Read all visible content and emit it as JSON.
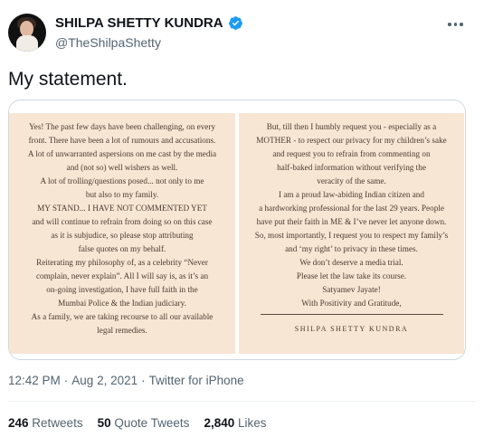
{
  "author": {
    "display_name": "SHILPA SHETTY KUNDRA",
    "handle": "@TheShilpaShetty",
    "verified_color": "#1d9bf0"
  },
  "tweet": {
    "text": "My statement."
  },
  "media": {
    "left_panel_lines": [
      "Yes! The past few days have been challenging, on every",
      "front. There have been a lot of rumours and accusations.",
      "A lot of unwarranted aspersions on me cast by the media",
      "and (not so) well wishers as well.",
      "A lot of trolling/questions posed... not only to me",
      "but also to my family.",
      "MY STAND... I HAVE NOT COMMENTED YET",
      "and will continue to refrain from doing so on this case",
      "as it is subjudice, so please stop attributing",
      "false quotes on my behalf.",
      "Reiterating my philosophy of, as a celebrity “Never",
      "complain, never explain”. All I will say is, as it’s an",
      "on-going investigation, I have full faith in the",
      "Mumbai Police & the Indian judiciary.",
      "As a family, we are taking recourse to all our available",
      "legal remedies."
    ],
    "right_panel_lines": [
      "But, till then I humbly request you - especially as a",
      "MOTHER - to respect our privacy for my children’s sake",
      "and request you to refrain from commenting on",
      "half-baked information without verifying the",
      "veracity of the same.",
      "I am a proud law-abiding Indian citizen and",
      "a hardworking professional for the last 29 years. People",
      "have put their faith in ME & I’ve never let anyone down.",
      "So, most importantly, I request you to respect my family’s",
      "and ‘my right’ to privacy in these times.",
      "We don’t deserve a media trial.",
      "Please let the law take its course.",
      "Satyamev Jayate!",
      "With Positivity and Gratitude,"
    ],
    "signature": "SHILPA SHETTY KUNDRA"
  },
  "meta": {
    "time": "12:42 PM",
    "dot1": "·",
    "date": "Aug 2, 2021",
    "dot2": "·",
    "source": "Twitter for iPhone"
  },
  "stats": {
    "retweets_count": "246",
    "retweets_label": "Retweets",
    "quotes_count": "50",
    "quotes_label": "Quote Tweets",
    "likes_count": "2,840",
    "likes_label": "Likes"
  }
}
